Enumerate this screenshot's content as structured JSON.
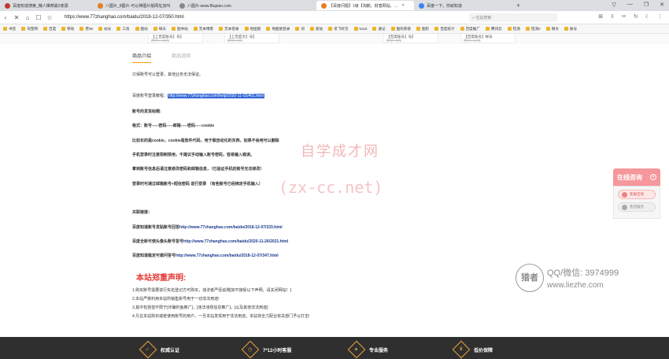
{
  "tabs": [
    {
      "title": "百度知道搜索_懒人推荐最2使源",
      "color": "#c0392b"
    },
    {
      "title": "八图片_8图片-可以神图片版网址加叫",
      "color": "#e67e22"
    },
    {
      "title": "八图片-www.8tupian.com",
      "color": "#888888"
    },
    {
      "title": "【百度问题】1级【淘鹅、财富网站、...",
      "color": "#e67e22",
      "active": true
    },
    {
      "title": "百度一下，你就知道",
      "color": "#3b82f6"
    }
  ],
  "window_controls": [
    "▽",
    "—",
    "❐",
    "✕"
  ],
  "address": {
    "url": "https://www.77zhanghao.com/baidu/2018-12-07/350.html",
    "search_placeholder": "在此搜索"
  },
  "nav_icons": [
    "‹",
    "✕",
    "⌂",
    "☐",
    "☆"
  ],
  "tools_icons": [
    "⊞",
    "⇩",
    "✂",
    "↻",
    "☾",
    "⋮"
  ],
  "bookmarks": [
    "书签",
    "淘宝网",
    "百度",
    "移动",
    "老50",
    "站长",
    "工具",
    "图站",
    "每天",
    "图书站",
    "无本博客",
    "无本登录",
    "地图屋",
    "地图屋登录",
    "词",
    "爱站",
    "讯飞听见",
    "5118",
    "通记",
    "图形获取",
    "图形",
    "百度统计",
    "百度推广",
    "腾讯云",
    "检测",
    "检测2",
    "微文",
    "账号"
  ],
  "product_strip": [
    {
      "name": "【上百度账号】号】",
      "price": "原价:- 18元"
    },
    {
      "name": "【上百度文】号】",
      "price": "原价: 3元"
    },
    {
      "name": "【百度账号】号】",
      "price": "原价: 3元"
    },
    {
      "name": "【百度账号】帐号",
      "price": "原价: 10元"
    }
  ],
  "content": {
    "tab_intro": "商品介绍",
    "tab_note": "商品说明",
    "guarantee": "只保账号可以登录，其他业务无法保证。",
    "tutorial_label": "百度账号登录教程：",
    "tutorial_link": "http://www.77zhanghao.com/help/2020-11-02/401.html",
    "format_title": "账号的发货标题:",
    "format": "格式：账号-----密码-----邮箱-----密码-----cookie",
    "note1": "比如长的是cookie，cookie是软件代码，用于做自动化的东西，如果不会用可以删除",
    "note2": "手机登录时注意限制禁用，不建议手动输入账号密码，容易输入错误。",
    "note3": "拿到账号信息后请注意修改密码和邮箱信息，（已验证手机的账号无法修改）",
    "note4": "登录时可通过邮箱账号+短信密码 进行登录 （有些账号已经绑定手机输入）",
    "related_title": "关联链接：",
    "related1_label": "百度知道账号发贴账号回答",
    "related1_url": "http://www.77zhanghao.com/baidu/2018-12-07/333.html",
    "related2_label": "百度全新可使头像头账号答号",
    "related2_url": "http://www.77zhanghao.com/baidu/2020-11-26/2021.html",
    "related3_label": "百度知道稳定可做问答号",
    "related3_url": "http://www.77zhanghao.com/baidu/2018-12-07/347.html",
    "decl_title": "本站郑重声明:",
    "decl1": "1.购买账号需要进行实名登记方可购买，违法者严惩追溯[如不接受以下声明，请关闭网站！]",
    "decl2": "2.本站严禁利用本站所销售账号用于一切非法用途!",
    "decl3": "3.其中包括但不限于[诈骗钓鱼推广]，[违法违规信息推广]，[以及其他非法用途]",
    "decl4": "4.凡在本站购买或者使用账号的用户，一旦本站发现用于非法用途，本站将全力配合有关部门予以打击!"
  },
  "watermark": {
    "title": "自学成才网",
    "domain": "(zx-cc.net)"
  },
  "consult": {
    "title": "在线咨询",
    "close": "×",
    "btn_consult": "客服咨询",
    "btn_service": "售后服务"
  },
  "liezhe": {
    "badge": "猎者",
    "line1": "QQ/微信: 3974999",
    "line2": "www.liezhe.com"
  },
  "footer": {
    "items": [
      "权威认证",
      "7*12小时客服",
      "专业服务",
      "低价保障"
    ],
    "bg_color": "#2f2f2f",
    "accent": "#e7a23b"
  }
}
